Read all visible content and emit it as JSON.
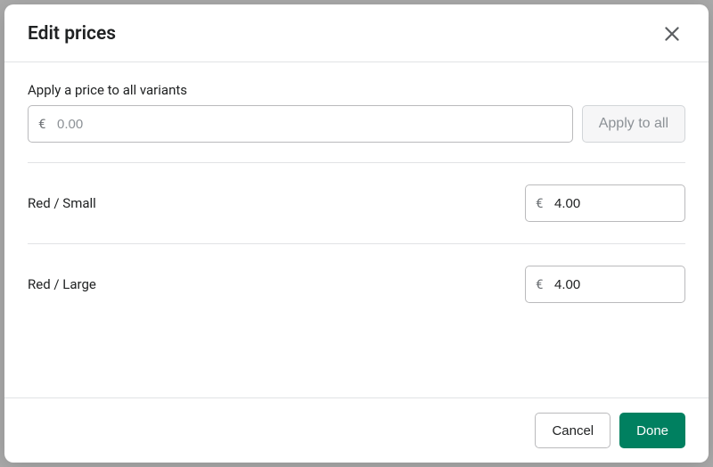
{
  "modal": {
    "title": "Edit prices",
    "apply_section": {
      "label": "Apply a price to all variants",
      "currency": "€",
      "placeholder": "0.00",
      "button_label": "Apply to all"
    },
    "variants": [
      {
        "name": "Red / Small",
        "currency": "€",
        "value": "4.00"
      },
      {
        "name": "Red / Large",
        "currency": "€",
        "value": "4.00"
      }
    ],
    "footer": {
      "cancel": "Cancel",
      "done": "Done"
    }
  }
}
